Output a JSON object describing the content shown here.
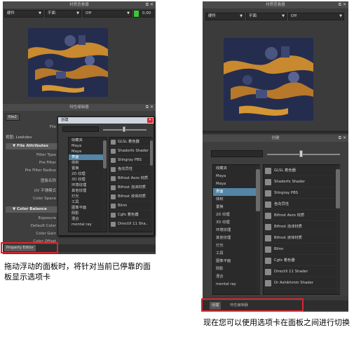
{
  "left": {
    "hypershade_title": "材质查看器",
    "render_mode": "硬件",
    "geometry": "平面",
    "environment": "Off",
    "exposure_value": "0.00",
    "editor_title": "特性编辑器",
    "tab_name": "file2",
    "texture_node_abbrev": "File",
    "view_label": "视图: Lookdev",
    "section_file_attributes": "File Attributes",
    "section_color_balance": "Color Balance",
    "file_attr_labels": [
      "Filter Type",
      "Pre Filter",
      "Pre Filter Radius",
      "图像名称",
      "UV 平铺模式",
      "Color Space"
    ],
    "color_balance_labels": [
      "Exposure",
      "Default Color",
      "Color Gain",
      "Color Offset"
    ],
    "create_title": "创建",
    "categories": [
      "收藏夹",
      "Maya",
      "Maya",
      "表面",
      "体积",
      "置换",
      "2D 纹理",
      "3D 纹理",
      "环境纹理",
      "其他纹理",
      "灯光",
      "工具",
      "图像平面",
      "阴影",
      "混合",
      "mental ray"
    ],
    "shaders": [
      "GLSL 着色器",
      "Shaderfx Shader",
      "Stingray PBS",
      "各向异性",
      "Bifrost Aero 材质",
      "Bifrost 泡沫材质",
      "Bifrost 液体材质",
      "Blinn",
      "Cgfx 着色器",
      "DirectX 11 Sha..",
      "头发管着色器"
    ],
    "property_editor_tab": "Property Editor",
    "caption": "拖动浮动的面板时，将针对当前已停靠的面板显示选项卡"
  },
  "right": {
    "hypershade_title": "材质查看器",
    "render_mode": "硬件",
    "geometry": "平面",
    "environment": "Off",
    "create_title": "创建",
    "categories": [
      "收藏夹",
      "Maya",
      "Maya",
      "表面",
      "体积",
      "置换",
      "2D 纹理",
      "3D 纹理",
      "环境纹理",
      "其他纹理",
      "灯光",
      "工具",
      "图像平面",
      "阴影",
      "混合",
      "mental ray"
    ],
    "shaders": [
      "GLSL 着色器",
      "Shaderfx Shader",
      "Stingray PBS",
      "各向异性",
      "Bifrost Aero 材质",
      "Bifrost 泡沫材质",
      "Bifrost 液体材质",
      "Blinn",
      "Cgfx 着色器",
      "DirectX 11 Shader",
      "Dr Ashikhmin Shader"
    ],
    "tab_create": "创建",
    "tab_attr_editor": "特性编辑器",
    "caption": "现在您可以使用选项卡在面板之间进行切换"
  },
  "colors": {
    "highlight": "#d9262c",
    "selection": "#5285a6",
    "panel": "#3e3e3e",
    "exposure_icon": "#3cc53c"
  },
  "icons": [
    "float-icon",
    "close-icon",
    "exposure-icon",
    "dropdown-arrow-icon",
    "shader-swatch-icon"
  ]
}
